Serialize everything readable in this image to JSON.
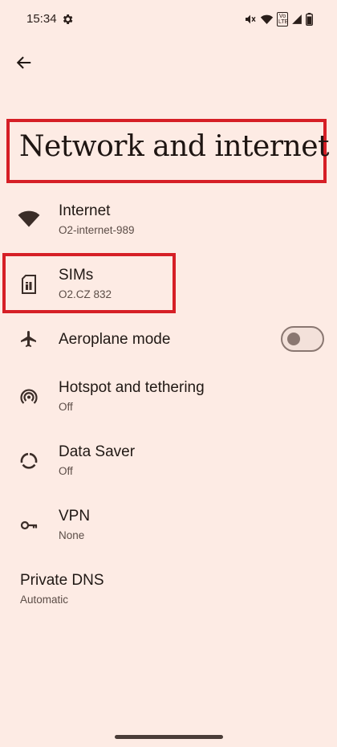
{
  "status_bar": {
    "time": "15:34",
    "volte_label": "Vo LTE",
    "icons": [
      "gear-icon",
      "mute-icon",
      "wifi-icon",
      "volte-icon",
      "signal-icon",
      "battery-icon"
    ]
  },
  "header": {
    "back_icon": "arrow-back-icon",
    "title": "Network and internet"
  },
  "items": [
    {
      "title": "Internet",
      "subtitle": "O2-internet-989",
      "icon": "wifi-icon"
    },
    {
      "title": "SIMs",
      "subtitle": "O2.CZ  832",
      "icon": "sim-card-icon"
    },
    {
      "title": "Aeroplane mode",
      "subtitle": "",
      "icon": "airplane-icon",
      "toggle_on": false
    },
    {
      "title": "Hotspot and tethering",
      "subtitle": "Off",
      "icon": "hotspot-icon"
    },
    {
      "title": "Data Saver",
      "subtitle": "Off",
      "icon": "data-saver-icon"
    },
    {
      "title": "VPN",
      "subtitle": "None",
      "icon": "vpn-key-icon"
    },
    {
      "title": "Private DNS",
      "subtitle": "Automatic"
    }
  ],
  "colors": {
    "background": "#fdebe4",
    "highlight_box": "#d61f26",
    "text_primary": "#201814",
    "text_secondary": "#5c4d47"
  }
}
